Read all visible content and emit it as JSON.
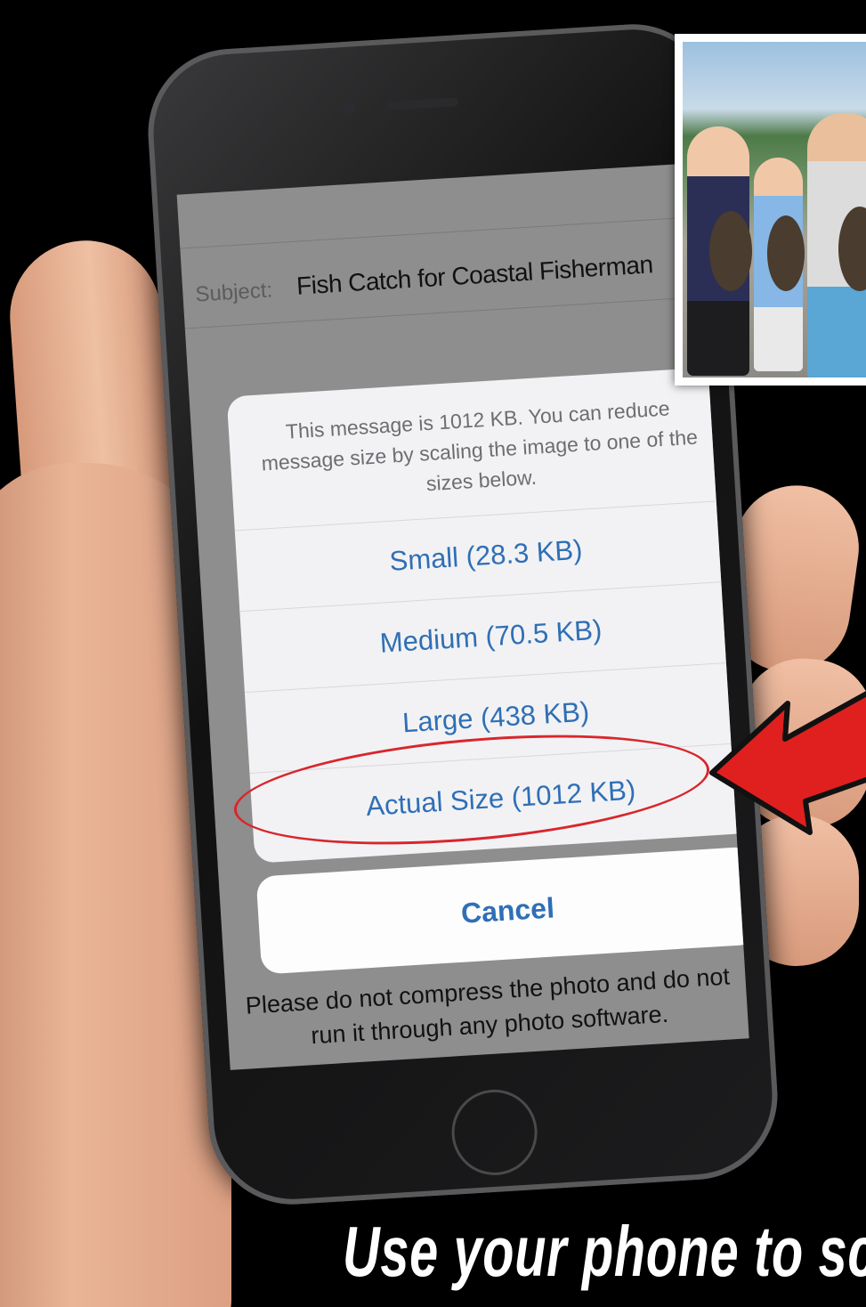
{
  "email": {
    "subject_label": "Subject:",
    "subject_value": "Fish Catch for Coastal Fisherman"
  },
  "resize_sheet": {
    "message": "This message is 1012 KB. You can reduce message size by scaling the image to one of the sizes below.",
    "options": [
      {
        "label": "Small (28.3 KB)"
      },
      {
        "label": "Medium (70.5 KB)"
      },
      {
        "label": "Large (438 KB)"
      },
      {
        "label": "Actual Size (1012 KB)"
      }
    ],
    "highlighted_option": "Actual Size (1012 KB)",
    "cancel_label": "Cancel"
  },
  "note": "Please do not compress the photo and do not run it through any photo software.",
  "caption": "Use your phone to sca",
  "colors": {
    "option_text": "#2f6fb5",
    "highlight": "#d8262c",
    "arrow": "#e0201f"
  }
}
